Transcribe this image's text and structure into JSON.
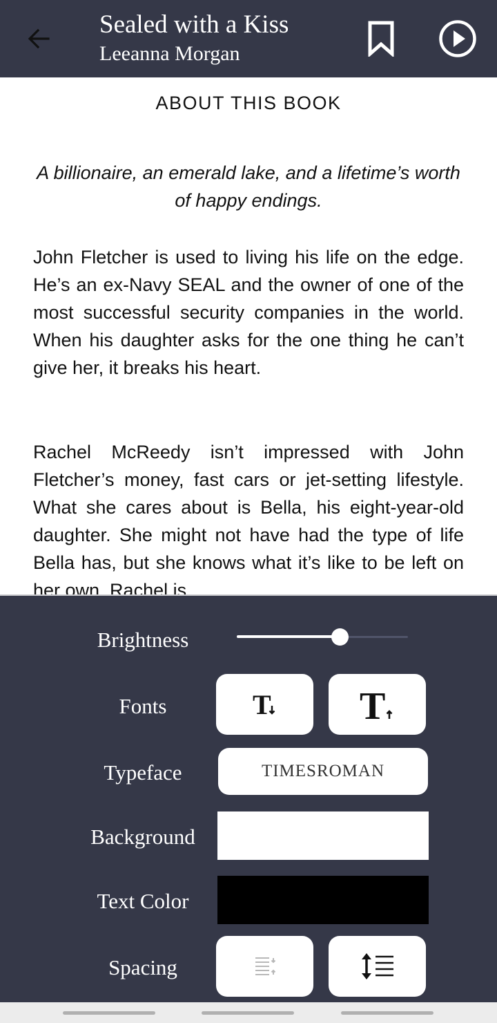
{
  "header": {
    "title": "Sealed with a Kiss",
    "author": "Leeanna Morgan",
    "icons": {
      "back": "arrow-back-icon",
      "bookmark": "bookmark-icon",
      "play": "play-circle-icon"
    }
  },
  "content": {
    "heading": "ABOUT THIS BOOK",
    "tagline": "A billionaire, an emerald lake, and a lifetime’s worth of happy endings.",
    "paragraphs": [
      "John Fletcher is used to living his life on the edge. He’s an ex-Navy SEAL and the owner of one of the most successful security compan­ies in the world. When his daughter asks for the one thing he can’t give her, it breaks his heart.",
      "Rachel McReedy isn’t impressed with John Fletcher’s money, fast cars or jet-setting lifestyle. What she cares about is Bella, his eight-year-old daughter. She might not have had the type of life Bella has, but she knows what it’s like to be left on her own. Rachel is"
    ]
  },
  "settings": {
    "brightness": {
      "label": "Brightness",
      "level_percent": 60
    },
    "fonts": {
      "label": "Fonts",
      "decrease_icon": "text-size-decrease-icon",
      "increase_icon": "text-size-increase-icon"
    },
    "typeface": {
      "label": "Typeface",
      "value": "TIMESROMAN"
    },
    "background": {
      "label": "Background",
      "color": "#ffffff"
    },
    "text_color": {
      "label": "Text Color",
      "color": "#000000"
    },
    "spacing": {
      "label": "Spacing",
      "decrease_icon": "line-spacing-decrease-icon",
      "increase_icon": "line-spacing-increase-icon"
    }
  },
  "theme": {
    "header_bg": "#353848",
    "panel_bg": "#353848",
    "content_bg": "#ffffff"
  }
}
